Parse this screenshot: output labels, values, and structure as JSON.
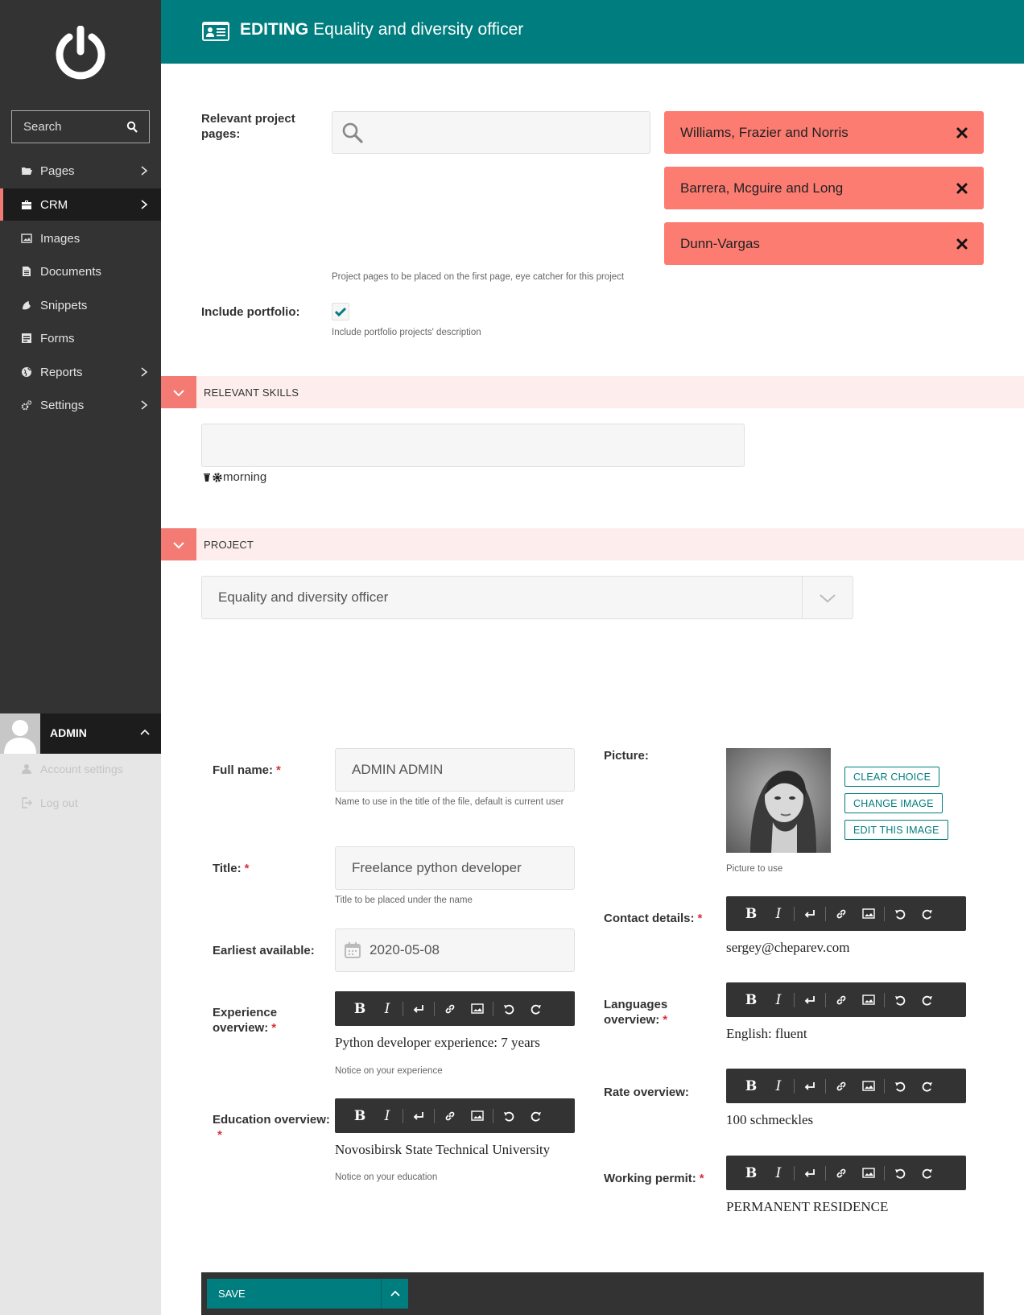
{
  "sidebar": {
    "search_placeholder": "Search",
    "items": [
      {
        "label": "Pages",
        "icon": "folder-open-icon",
        "has_children": true
      },
      {
        "label": "CRM",
        "icon": "briefcase-icon",
        "has_children": true,
        "active": true
      },
      {
        "label": "Images",
        "icon": "image-icon",
        "has_children": false
      },
      {
        "label": "Documents",
        "icon": "document-icon",
        "has_children": false
      },
      {
        "label": "Snippets",
        "icon": "snippet-icon",
        "has_children": false
      },
      {
        "label": "Forms",
        "icon": "form-icon",
        "has_children": false
      },
      {
        "label": "Reports",
        "icon": "globe-icon",
        "has_children": true
      },
      {
        "label": "Settings",
        "icon": "cogs-icon",
        "has_children": true
      }
    ],
    "user": {
      "name": "ADMIN",
      "account_settings": "Account settings",
      "logout": "Log out"
    }
  },
  "header": {
    "action": "EDITING",
    "title": "Equality and diversity officer"
  },
  "relevant_projects": {
    "label": "Relevant project pages:",
    "help": "Project pages to be placed on the first page, eye catcher for this project",
    "selected": [
      "Williams, Frazier and Norris",
      "Barrera, Mcguire and Long",
      "Dunn-Vargas"
    ]
  },
  "include_portfolio": {
    "label": "Include portfolio:",
    "checked": true,
    "help": "Include portfolio projects' description"
  },
  "sections": {
    "skills": "RELEVANT SKILLS",
    "project": "PROJECT"
  },
  "skills": {
    "items": [
      "morning"
    ]
  },
  "project": {
    "selected": "Equality and diversity officer"
  },
  "form": {
    "full_name": {
      "label": "Full name:",
      "value": "ADMIN ADMIN",
      "help": "Name to use in the title of the file, default is current user"
    },
    "title": {
      "label": "Title:",
      "value": "Freelance python developer",
      "help": "Title to be placed under the name"
    },
    "earliest_available": {
      "label": "Earliest available:",
      "value": "2020-05-08"
    },
    "experience": {
      "label_line1": "Experience",
      "label_line2": "overview:",
      "value": "Python developer experience: 7 years",
      "help": "Notice on your experience"
    },
    "education": {
      "label": "Education overview:",
      "value": "Novosibirsk State Technical University",
      "help": "Notice on your education"
    },
    "picture": {
      "label": "Picture:",
      "help": "Picture to use",
      "clear": "CLEAR CHOICE",
      "change": "CHANGE IMAGE",
      "edit": "EDIT THIS IMAGE"
    },
    "contact": {
      "label": "Contact details:",
      "value": "sergey@cheparev.com"
    },
    "languages": {
      "label_line1": "Languages",
      "label_line2": "overview:",
      "value": "English: fluent"
    },
    "rate": {
      "label": "Rate overview:",
      "value": "100 schmeckles"
    },
    "permit": {
      "label": "Working permit:",
      "value": "PERMANENT RESIDENCE"
    }
  },
  "footer": {
    "save_label": "SAVE"
  },
  "colors": {
    "brand": "#007d7e",
    "accent": "#fd7c72",
    "sidebar": "#333333"
  }
}
